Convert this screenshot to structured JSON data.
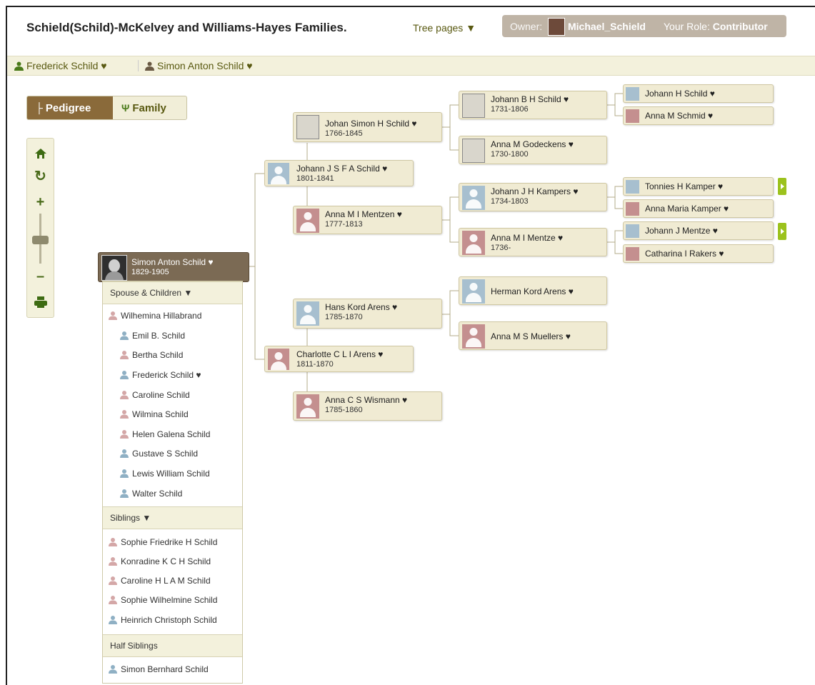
{
  "header": {
    "title": "Schield(Schild)-McKelvey and Williams-Hayes Families.",
    "tree_pages": "Tree pages ▼",
    "owner_label": "Owner:",
    "owner_name": "Michael_Schield",
    "role_label": "Your Role:",
    "role_value": "Contributor"
  },
  "breadcrumbs": [
    {
      "label": "Frederick Schild ♥"
    },
    {
      "label": "Simon Anton Schild ♥"
    }
  ],
  "view_tabs": {
    "pedigree": "Pedigree",
    "family": "Family"
  },
  "focus": {
    "name": "Simon Anton Schild ♥",
    "dates": "1829-1905"
  },
  "parents": [
    {
      "name": "Johann J S F A Schild ♥",
      "dates": "1801-1841",
      "gender": "m"
    },
    {
      "name": "Charlotte C L I Arens ♥",
      "dates": "1811-1870",
      "gender": "f"
    }
  ],
  "grandparents": [
    {
      "name": "Johan Simon H Schild ♥",
      "dates": "1766-1845"
    },
    {
      "name": "Anna M I Mentzen ♥",
      "dates": "1777-1813"
    },
    {
      "name": "Hans Kord Arens ♥",
      "dates": "1785-1870"
    },
    {
      "name": "Anna C S Wismann ♥",
      "dates": "1785-1860"
    }
  ],
  "great_grandparents": [
    {
      "name": "Johann B H Schild ♥",
      "dates": "1731-1806"
    },
    {
      "name": "Anna M Godeckens ♥",
      "dates": "1730-1800"
    },
    {
      "name": "Johann J H Kampers ♥",
      "dates": "1734-1803"
    },
    {
      "name": "Anna M I Mentze ♥",
      "dates": "1736-"
    },
    {
      "name": "Herman Kord Arens ♥",
      "dates": ""
    },
    {
      "name": "Anna M S Muellers ♥",
      "dates": ""
    }
  ],
  "gg_grandparents": [
    {
      "name": "Johann H Schild ♥"
    },
    {
      "name": "Anna M Schmid ♥"
    },
    {
      "name": "Tonnies H Kamper ♥"
    },
    {
      "name": "Anna Maria Kamper ♥"
    },
    {
      "name": "Johann J Mentze ♥"
    },
    {
      "name": "Catharina I Rakers ♥"
    }
  ],
  "panel": {
    "spouse_header": "Spouse & Children ▼",
    "spouse": "Wilhemina Hillabrand",
    "children": [
      "Emil B. Schild",
      "Bertha Schild",
      "Frederick Schild ♥",
      "Caroline Schild",
      "Wilmina Schild",
      "Helen Galena Schild",
      "Gustave S Schild",
      "Lewis William Schild",
      "Walter Schild"
    ],
    "siblings_header": "Siblings ▼",
    "siblings": [
      "Sophie Friedrike H Schild",
      "Konradine K C H Schild",
      "Caroline H L A M Schild",
      "Sophie Wilhelmine Schild",
      "Heinrich Christoph Schild"
    ],
    "half_header": "Half Siblings",
    "half_siblings": [
      "Simon Bernhard Schild"
    ]
  },
  "colors": {
    "male": "#a7bfcf",
    "female": "#c48f8f",
    "accent": "#8a6a3a",
    "more": "#9cc21d"
  }
}
